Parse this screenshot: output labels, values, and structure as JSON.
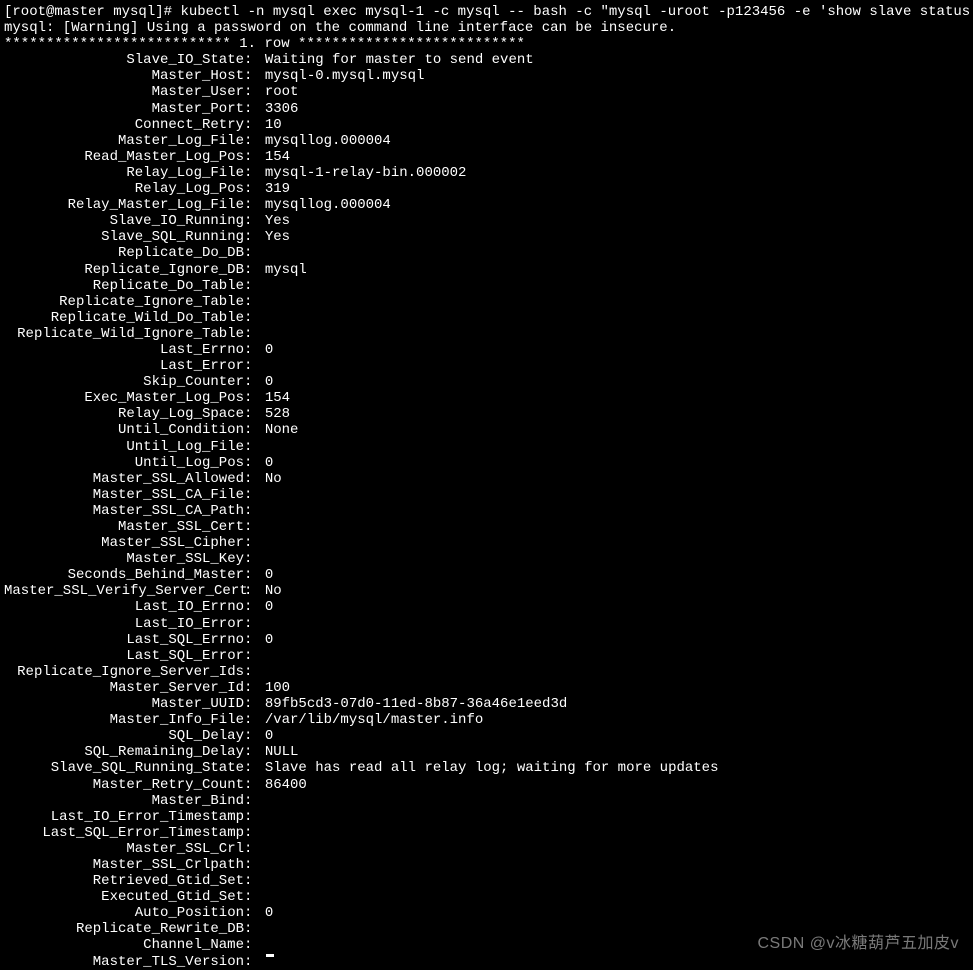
{
  "prompt": {
    "user_host": "[root@master mysql]#",
    "command": "kubectl -n mysql exec mysql-1 -c mysql -- bash -c \"mysql -uroot -p123456 -e 'show slave status \\G'\""
  },
  "warning": "mysql: [Warning] Using a password on the command line interface can be insecure.",
  "row_separator": "*************************** 1. row ***************************",
  "slave_status": [
    {
      "label": "Slave_IO_State",
      "value": "Waiting for master to send event"
    },
    {
      "label": "Master_Host",
      "value": "mysql-0.mysql.mysql"
    },
    {
      "label": "Master_User",
      "value": "root"
    },
    {
      "label": "Master_Port",
      "value": "3306"
    },
    {
      "label": "Connect_Retry",
      "value": "10"
    },
    {
      "label": "Master_Log_File",
      "value": "mysqllog.000004"
    },
    {
      "label": "Read_Master_Log_Pos",
      "value": "154"
    },
    {
      "label": "Relay_Log_File",
      "value": "mysql-1-relay-bin.000002"
    },
    {
      "label": "Relay_Log_Pos",
      "value": "319"
    },
    {
      "label": "Relay_Master_Log_File",
      "value": "mysqllog.000004"
    },
    {
      "label": "Slave_IO_Running",
      "value": "Yes"
    },
    {
      "label": "Slave_SQL_Running",
      "value": "Yes"
    },
    {
      "label": "Replicate_Do_DB",
      "value": ""
    },
    {
      "label": "Replicate_Ignore_DB",
      "value": "mysql"
    },
    {
      "label": "Replicate_Do_Table",
      "value": ""
    },
    {
      "label": "Replicate_Ignore_Table",
      "value": ""
    },
    {
      "label": "Replicate_Wild_Do_Table",
      "value": ""
    },
    {
      "label": "Replicate_Wild_Ignore_Table",
      "value": ""
    },
    {
      "label": "Last_Errno",
      "value": "0"
    },
    {
      "label": "Last_Error",
      "value": ""
    },
    {
      "label": "Skip_Counter",
      "value": "0"
    },
    {
      "label": "Exec_Master_Log_Pos",
      "value": "154"
    },
    {
      "label": "Relay_Log_Space",
      "value": "528"
    },
    {
      "label": "Until_Condition",
      "value": "None"
    },
    {
      "label": "Until_Log_File",
      "value": ""
    },
    {
      "label": "Until_Log_Pos",
      "value": "0"
    },
    {
      "label": "Master_SSL_Allowed",
      "value": "No"
    },
    {
      "label": "Master_SSL_CA_File",
      "value": ""
    },
    {
      "label": "Master_SSL_CA_Path",
      "value": ""
    },
    {
      "label": "Master_SSL_Cert",
      "value": ""
    },
    {
      "label": "Master_SSL_Cipher",
      "value": ""
    },
    {
      "label": "Master_SSL_Key",
      "value": ""
    },
    {
      "label": "Seconds_Behind_Master",
      "value": "0"
    },
    {
      "label": "Master_SSL_Verify_Server_Cert",
      "value": "No"
    },
    {
      "label": "Last_IO_Errno",
      "value": "0"
    },
    {
      "label": "Last_IO_Error",
      "value": ""
    },
    {
      "label": "Last_SQL_Errno",
      "value": "0"
    },
    {
      "label": "Last_SQL_Error",
      "value": ""
    },
    {
      "label": "Replicate_Ignore_Server_Ids",
      "value": ""
    },
    {
      "label": "Master_Server_Id",
      "value": "100"
    },
    {
      "label": "Master_UUID",
      "value": "89fb5cd3-07d0-11ed-8b87-36a46e1eed3d"
    },
    {
      "label": "Master_Info_File",
      "value": "/var/lib/mysql/master.info"
    },
    {
      "label": "SQL_Delay",
      "value": "0"
    },
    {
      "label": "SQL_Remaining_Delay",
      "value": "NULL"
    },
    {
      "label": "Slave_SQL_Running_State",
      "value": "Slave has read all relay log; waiting for more updates"
    },
    {
      "label": "Master_Retry_Count",
      "value": "86400"
    },
    {
      "label": "Master_Bind",
      "value": ""
    },
    {
      "label": "Last_IO_Error_Timestamp",
      "value": ""
    },
    {
      "label": "Last_SQL_Error_Timestamp",
      "value": ""
    },
    {
      "label": "Master_SSL_Crl",
      "value": ""
    },
    {
      "label": "Master_SSL_Crlpath",
      "value": ""
    },
    {
      "label": "Retrieved_Gtid_Set",
      "value": ""
    },
    {
      "label": "Executed_Gtid_Set",
      "value": ""
    },
    {
      "label": "Auto_Position",
      "value": "0"
    },
    {
      "label": "Replicate_Rewrite_DB",
      "value": ""
    },
    {
      "label": "Channel_Name",
      "value": ""
    },
    {
      "label": "Master_TLS_Version",
      "value": ""
    }
  ],
  "watermark": "CSDN @v冰糖葫芦五加皮v"
}
